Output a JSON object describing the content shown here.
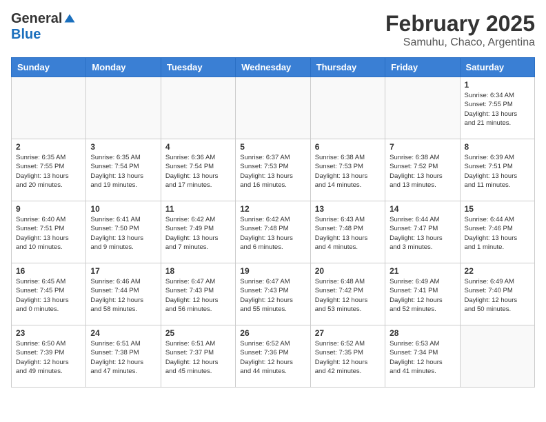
{
  "header": {
    "logo_general": "General",
    "logo_blue": "Blue",
    "title": "February 2025",
    "subtitle": "Samuhu, Chaco, Argentina"
  },
  "days_of_week": [
    "Sunday",
    "Monday",
    "Tuesday",
    "Wednesday",
    "Thursday",
    "Friday",
    "Saturday"
  ],
  "weeks": [
    [
      {
        "day": "",
        "info": ""
      },
      {
        "day": "",
        "info": ""
      },
      {
        "day": "",
        "info": ""
      },
      {
        "day": "",
        "info": ""
      },
      {
        "day": "",
        "info": ""
      },
      {
        "day": "",
        "info": ""
      },
      {
        "day": "1",
        "info": "Sunrise: 6:34 AM\nSunset: 7:55 PM\nDaylight: 13 hours\nand 21 minutes."
      }
    ],
    [
      {
        "day": "2",
        "info": "Sunrise: 6:35 AM\nSunset: 7:55 PM\nDaylight: 13 hours\nand 20 minutes."
      },
      {
        "day": "3",
        "info": "Sunrise: 6:35 AM\nSunset: 7:54 PM\nDaylight: 13 hours\nand 19 minutes."
      },
      {
        "day": "4",
        "info": "Sunrise: 6:36 AM\nSunset: 7:54 PM\nDaylight: 13 hours\nand 17 minutes."
      },
      {
        "day": "5",
        "info": "Sunrise: 6:37 AM\nSunset: 7:53 PM\nDaylight: 13 hours\nand 16 minutes."
      },
      {
        "day": "6",
        "info": "Sunrise: 6:38 AM\nSunset: 7:53 PM\nDaylight: 13 hours\nand 14 minutes."
      },
      {
        "day": "7",
        "info": "Sunrise: 6:38 AM\nSunset: 7:52 PM\nDaylight: 13 hours\nand 13 minutes."
      },
      {
        "day": "8",
        "info": "Sunrise: 6:39 AM\nSunset: 7:51 PM\nDaylight: 13 hours\nand 11 minutes."
      }
    ],
    [
      {
        "day": "9",
        "info": "Sunrise: 6:40 AM\nSunset: 7:51 PM\nDaylight: 13 hours\nand 10 minutes."
      },
      {
        "day": "10",
        "info": "Sunrise: 6:41 AM\nSunset: 7:50 PM\nDaylight: 13 hours\nand 9 minutes."
      },
      {
        "day": "11",
        "info": "Sunrise: 6:42 AM\nSunset: 7:49 PM\nDaylight: 13 hours\nand 7 minutes."
      },
      {
        "day": "12",
        "info": "Sunrise: 6:42 AM\nSunset: 7:48 PM\nDaylight: 13 hours\nand 6 minutes."
      },
      {
        "day": "13",
        "info": "Sunrise: 6:43 AM\nSunset: 7:48 PM\nDaylight: 13 hours\nand 4 minutes."
      },
      {
        "day": "14",
        "info": "Sunrise: 6:44 AM\nSunset: 7:47 PM\nDaylight: 13 hours\nand 3 minutes."
      },
      {
        "day": "15",
        "info": "Sunrise: 6:44 AM\nSunset: 7:46 PM\nDaylight: 13 hours\nand 1 minute."
      }
    ],
    [
      {
        "day": "16",
        "info": "Sunrise: 6:45 AM\nSunset: 7:45 PM\nDaylight: 13 hours\nand 0 minutes."
      },
      {
        "day": "17",
        "info": "Sunrise: 6:46 AM\nSunset: 7:44 PM\nDaylight: 12 hours\nand 58 minutes."
      },
      {
        "day": "18",
        "info": "Sunrise: 6:47 AM\nSunset: 7:43 PM\nDaylight: 12 hours\nand 56 minutes."
      },
      {
        "day": "19",
        "info": "Sunrise: 6:47 AM\nSunset: 7:43 PM\nDaylight: 12 hours\nand 55 minutes."
      },
      {
        "day": "20",
        "info": "Sunrise: 6:48 AM\nSunset: 7:42 PM\nDaylight: 12 hours\nand 53 minutes."
      },
      {
        "day": "21",
        "info": "Sunrise: 6:49 AM\nSunset: 7:41 PM\nDaylight: 12 hours\nand 52 minutes."
      },
      {
        "day": "22",
        "info": "Sunrise: 6:49 AM\nSunset: 7:40 PM\nDaylight: 12 hours\nand 50 minutes."
      }
    ],
    [
      {
        "day": "23",
        "info": "Sunrise: 6:50 AM\nSunset: 7:39 PM\nDaylight: 12 hours\nand 49 minutes."
      },
      {
        "day": "24",
        "info": "Sunrise: 6:51 AM\nSunset: 7:38 PM\nDaylight: 12 hours\nand 47 minutes."
      },
      {
        "day": "25",
        "info": "Sunrise: 6:51 AM\nSunset: 7:37 PM\nDaylight: 12 hours\nand 45 minutes."
      },
      {
        "day": "26",
        "info": "Sunrise: 6:52 AM\nSunset: 7:36 PM\nDaylight: 12 hours\nand 44 minutes."
      },
      {
        "day": "27",
        "info": "Sunrise: 6:52 AM\nSunset: 7:35 PM\nDaylight: 12 hours\nand 42 minutes."
      },
      {
        "day": "28",
        "info": "Sunrise: 6:53 AM\nSunset: 7:34 PM\nDaylight: 12 hours\nand 41 minutes."
      },
      {
        "day": "",
        "info": ""
      }
    ]
  ]
}
